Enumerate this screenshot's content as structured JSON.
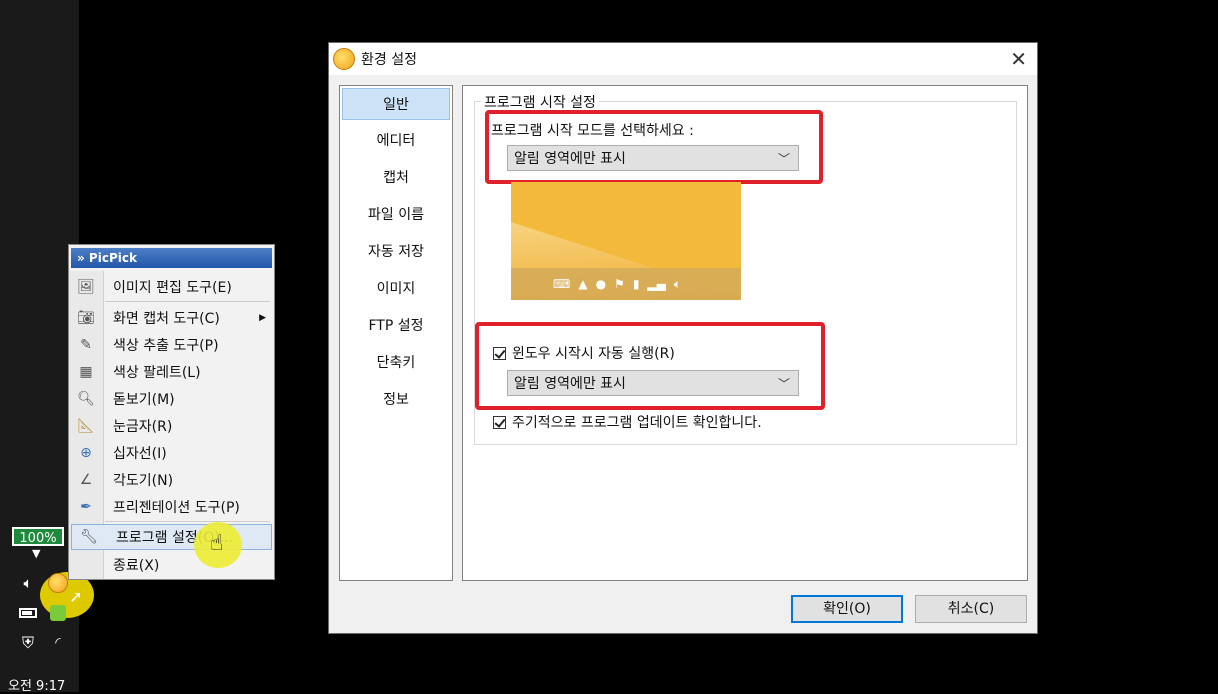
{
  "taskbar": {
    "zoom_badge": "100%",
    "clock": "오전 9:17"
  },
  "context_menu": {
    "title": "» PicPick",
    "items": [
      {
        "label": "이미지 편집 도구(E)",
        "icon": "image-edit-icon"
      },
      {
        "label": "화면 캡처 도구(C)",
        "icon": "camera-icon",
        "submenu": true
      },
      {
        "label": "색상 추출 도구(P)",
        "icon": "eyedropper-icon"
      },
      {
        "label": "색상 팔레트(L)",
        "icon": "palette-grid-icon"
      },
      {
        "label": "돋보기(M)",
        "icon": "magnifier-icon"
      },
      {
        "label": "눈금자(R)",
        "icon": "ruler-icon"
      },
      {
        "label": "십자선(I)",
        "icon": "crosshair-icon"
      },
      {
        "label": "각도기(N)",
        "icon": "protractor-icon"
      },
      {
        "label": "프리젠테이션 도구(P)",
        "icon": "pen-icon"
      },
      {
        "label": "프로그램 설정(O)...",
        "icon": "wrench-icon",
        "highlighted": true
      },
      {
        "label": "종료(X)",
        "icon": ""
      }
    ]
  },
  "dialog": {
    "title": "환경 설정",
    "nav": [
      "일반",
      "에디터",
      "캡처",
      "파일 이름",
      "자동 저장",
      "이미지",
      "FTP 설정",
      "단축키",
      "정보"
    ],
    "selected_nav": "일반",
    "group_label": "프로그램 시작 설정",
    "start_mode_label": "프로그램 시작 모드를 선택하세요 :",
    "start_mode_value": "알림 영역에만 표시",
    "autorun_label": "윈도우 시작시 자동 실행(R)",
    "autorun_checked": true,
    "autorun_mode_value": "알림 영역에만 표시",
    "update_label": "주기적으로 프로그램 업데이트 확인합니다.",
    "update_checked": true,
    "ok_label": "확인(O)",
    "cancel_label": "취소(C)"
  },
  "colors": {
    "highlight_red": "#e0202a",
    "selection_blue": "#cfe3f8",
    "badge_green": "#1f8a3c"
  }
}
